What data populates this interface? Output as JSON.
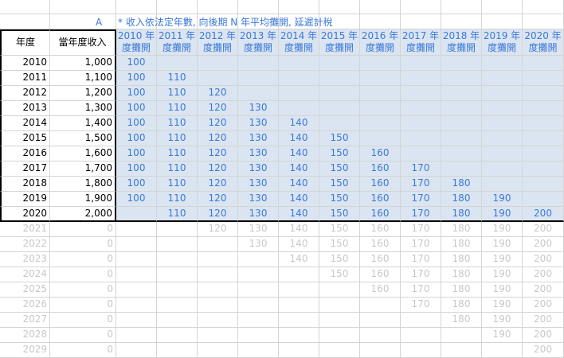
{
  "top_row": {
    "col_b_letter": "A",
    "note": "* 收入依法定年數, 向後期 N 年平均攤開, 延遲計稅"
  },
  "headers": {
    "year": "年度",
    "income": "當年度收入",
    "amort_cols": [
      "2010 年\n度攤開",
      "2011 年\n度攤開",
      "2012 年\n度攤開",
      "2013 年\n度攤開",
      "2014 年\n度攤開",
      "2015 年\n度攤開",
      "2016 年\n度攤開",
      "2017 年\n度攤開",
      "2018 年\n度攤開",
      "2019 年\n度攤開",
      "2020 年\n度攤開"
    ]
  },
  "rows": [
    {
      "year": "2010",
      "income": "1,000",
      "vals": [
        "100",
        "",
        "",
        "",
        "",
        "",
        "",
        "",
        "",
        "",
        ""
      ]
    },
    {
      "year": "2011",
      "income": "1,100",
      "vals": [
        "100",
        "110",
        "",
        "",
        "",
        "",
        "",
        "",
        "",
        "",
        ""
      ]
    },
    {
      "year": "2012",
      "income": "1,200",
      "vals": [
        "100",
        "110",
        "120",
        "",
        "",
        "",
        "",
        "",
        "",
        "",
        ""
      ]
    },
    {
      "year": "2013",
      "income": "1,300",
      "vals": [
        "100",
        "110",
        "120",
        "130",
        "",
        "",
        "",
        "",
        "",
        "",
        ""
      ]
    },
    {
      "year": "2014",
      "income": "1,400",
      "vals": [
        "100",
        "110",
        "120",
        "130",
        "140",
        "",
        "",
        "",
        "",
        "",
        ""
      ]
    },
    {
      "year": "2015",
      "income": "1,500",
      "vals": [
        "100",
        "110",
        "120",
        "130",
        "140",
        "150",
        "",
        "",
        "",
        "",
        ""
      ]
    },
    {
      "year": "2016",
      "income": "1,600",
      "vals": [
        "100",
        "110",
        "120",
        "130",
        "140",
        "150",
        "160",
        "",
        "",
        "",
        ""
      ]
    },
    {
      "year": "2017",
      "income": "1,700",
      "vals": [
        "100",
        "110",
        "120",
        "130",
        "140",
        "150",
        "160",
        "170",
        "",
        "",
        ""
      ]
    },
    {
      "year": "2018",
      "income": "1,800",
      "vals": [
        "100",
        "110",
        "120",
        "130",
        "140",
        "150",
        "160",
        "170",
        "180",
        "",
        ""
      ]
    },
    {
      "year": "2019",
      "income": "1,900",
      "vals": [
        "100",
        "110",
        "120",
        "130",
        "140",
        "150",
        "160",
        "170",
        "180",
        "190",
        ""
      ]
    },
    {
      "year": "2020",
      "income": "2,000",
      "vals": [
        "",
        "110",
        "120",
        "130",
        "140",
        "150",
        "160",
        "170",
        "180",
        "190",
        "200"
      ]
    },
    {
      "year": "2021",
      "income": "0",
      "vals": [
        "",
        "",
        "120",
        "130",
        "140",
        "150",
        "160",
        "170",
        "180",
        "190",
        "200"
      ]
    },
    {
      "year": "2022",
      "income": "0",
      "vals": [
        "",
        "",
        "",
        "130",
        "140",
        "150",
        "160",
        "170",
        "180",
        "190",
        "200"
      ]
    },
    {
      "year": "2023",
      "income": "0",
      "vals": [
        "",
        "",
        "",
        "",
        "140",
        "150",
        "160",
        "170",
        "180",
        "190",
        "200"
      ]
    },
    {
      "year": "2024",
      "income": "0",
      "vals": [
        "",
        "",
        "",
        "",
        "",
        "150",
        "160",
        "170",
        "180",
        "190",
        "200"
      ]
    },
    {
      "year": "2025",
      "income": "0",
      "vals": [
        "",
        "",
        "",
        "",
        "",
        "",
        "160",
        "170",
        "180",
        "190",
        "200"
      ]
    },
    {
      "year": "2026",
      "income": "0",
      "vals": [
        "",
        "",
        "",
        "",
        "",
        "",
        "",
        "170",
        "180",
        "190",
        "200"
      ]
    },
    {
      "year": "2027",
      "income": "0",
      "vals": [
        "",
        "",
        "",
        "",
        "",
        "",
        "",
        "",
        "180",
        "190",
        "200"
      ]
    },
    {
      "year": "2028",
      "income": "0",
      "vals": [
        "",
        "",
        "",
        "",
        "",
        "",
        "",
        "",
        "",
        "190",
        "200"
      ]
    },
    {
      "year": "2029",
      "income": "0",
      "vals": [
        "",
        "",
        "",
        "",
        "",
        "",
        "",
        "",
        "",
        "",
        "200"
      ]
    }
  ],
  "colors": {
    "blue_fill": "#dbe5f1",
    "blue_text": "#3b78d8",
    "grey_text": "#c8c8c8",
    "grid": "#d4d4d4"
  }
}
